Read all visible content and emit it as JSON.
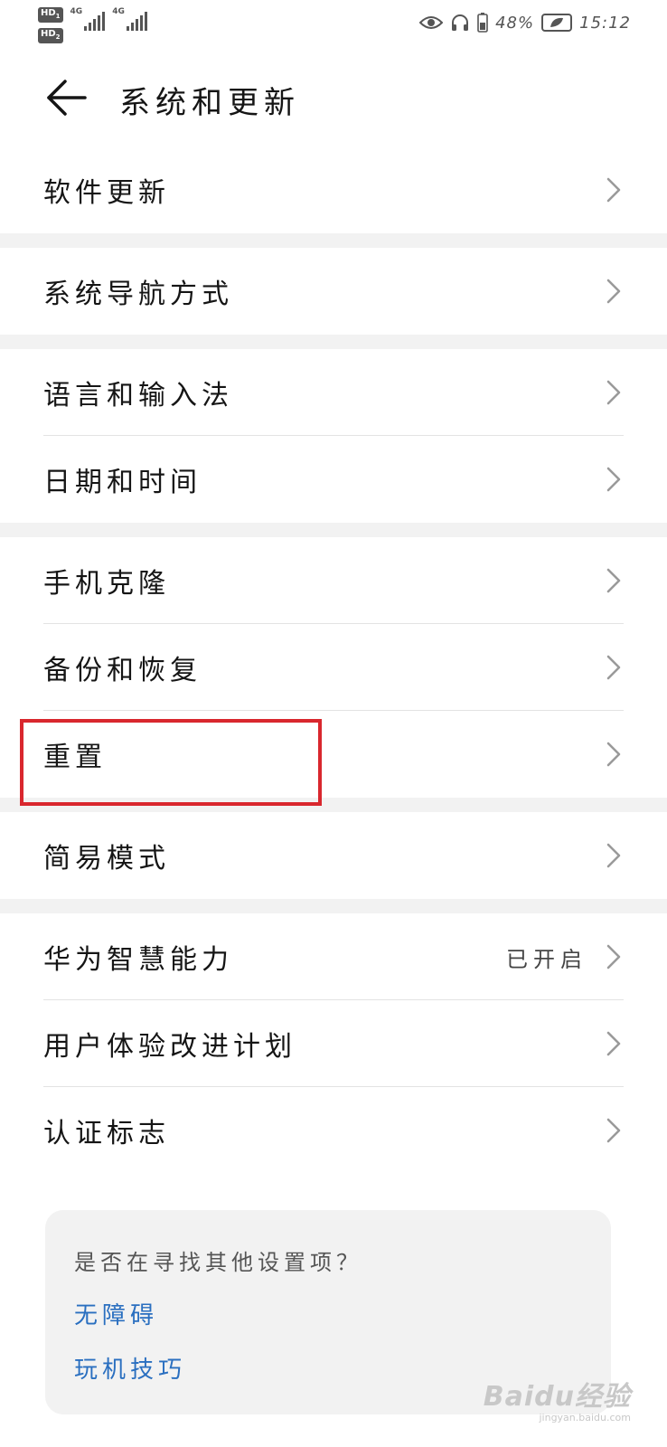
{
  "status_bar": {
    "hd_badge_1": "HD",
    "hd_badge_1_sub": "1",
    "hd_badge_2": "HD",
    "hd_badge_2_sub": "2",
    "network_1": "4G",
    "network_2": "4G",
    "battery_percent": "48%",
    "clock": "15:12",
    "icons": [
      "eye-icon",
      "headphones-icon",
      "battery-icon",
      "power-saving-icon"
    ]
  },
  "header": {
    "title": "系统和更新",
    "back_icon": "arrow-left-icon"
  },
  "groups": [
    {
      "items": [
        {
          "label": "软件更新"
        }
      ]
    },
    {
      "items": [
        {
          "label": "系统导航方式"
        }
      ]
    },
    {
      "items": [
        {
          "label": "语言和输入法"
        },
        {
          "label": "日期和时间"
        }
      ]
    },
    {
      "items": [
        {
          "label": "手机克隆"
        },
        {
          "label": "备份和恢复"
        },
        {
          "label": "重置",
          "highlighted": true
        }
      ]
    },
    {
      "items": [
        {
          "label": "简易模式"
        }
      ]
    },
    {
      "items": [
        {
          "label": "华为智慧能力",
          "value": "已开启"
        },
        {
          "label": "用户体验改进计划"
        },
        {
          "label": "认证标志"
        }
      ]
    }
  ],
  "suggestion_card": {
    "title": "是否在寻找其他设置项？",
    "links": [
      "无障碍",
      "玩机技巧"
    ]
  },
  "watermark": {
    "main": "Baidu经验",
    "sub": "jingyan.baidu.com"
  },
  "colors": {
    "highlight_border": "#d9272e",
    "link": "#2a6fc0",
    "group_gap": "#f2f2f2"
  }
}
